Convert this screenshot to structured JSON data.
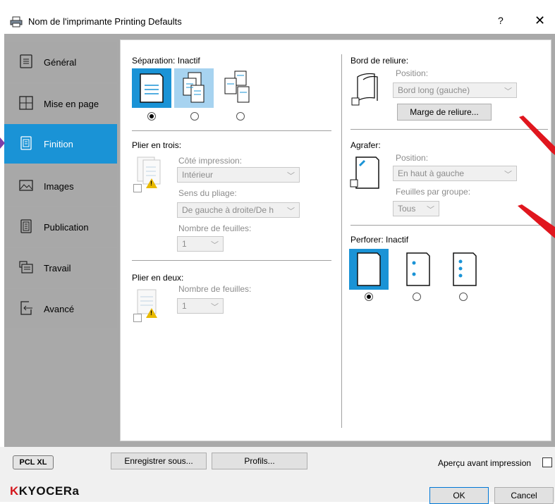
{
  "window": {
    "title": "Nom de l'imprimante Printing Defaults",
    "help": "?",
    "close": "✕"
  },
  "sidebar": {
    "items": [
      {
        "label": "Général",
        "icon": "general-icon"
      },
      {
        "label": "Mise en page",
        "icon": "layout-icon"
      },
      {
        "label": "Finition",
        "icon": "finishing-icon",
        "active": true
      },
      {
        "label": "Images",
        "icon": "image-icon"
      },
      {
        "label": "Publication",
        "icon": "publishing-icon"
      },
      {
        "label": "Travail",
        "icon": "job-icon"
      },
      {
        "label": "Avancé",
        "icon": "advanced-icon"
      }
    ]
  },
  "finishing": {
    "separation": {
      "label": "Séparation:",
      "value": "Inactif",
      "selected": 0
    },
    "trifold": {
      "title": "Plier en trois:",
      "side_label": "Côté impression:",
      "side_value": "Intérieur",
      "direction_label": "Sens du pliage:",
      "direction_value": "De gauche à droite/De h",
      "sheets_label": "Nombre de feuilles:",
      "sheets_value": "1"
    },
    "bifold": {
      "title": "Plier en deux:",
      "sheets_label": "Nombre de feuilles:",
      "sheets_value": "1"
    },
    "binding": {
      "title": "Bord de reliure:",
      "position_label": "Position:",
      "position_value": "Bord long (gauche)",
      "margin_button": "Marge de reliure..."
    },
    "staple": {
      "title": "Agrafer:",
      "position_label": "Position:",
      "position_value": "En haut à gauche",
      "sheets_label": "Feuilles par groupe:",
      "sheets_value": "Tous"
    },
    "punch": {
      "label": "Perforer:",
      "value": "Inactif",
      "selected": 0
    }
  },
  "bottom": {
    "pcl": "PCL XL",
    "save_as": "Enregistrer sous...",
    "profiles": "Profils...",
    "preview": "Aperçu avant impression",
    "ok": "OK",
    "cancel": "Cancel",
    "brand_k": "K",
    "brand_rest": "KYOCERa"
  },
  "colors": {
    "accent": "#1a93d6",
    "sidebar": "#a8a8a8",
    "arrow": "#e0161e",
    "warning": "#e8b900"
  }
}
